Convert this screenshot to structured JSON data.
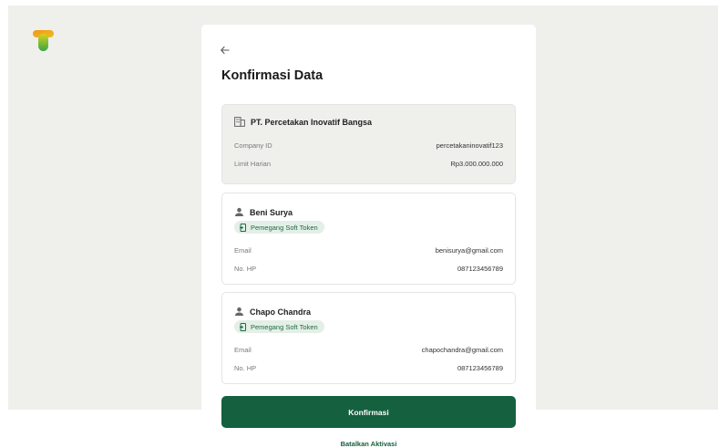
{
  "header": {
    "back_icon": "arrow-left-icon",
    "title": "Konfirmasi Data"
  },
  "company": {
    "name": "PT. Percetakan Inovatif Bangsa",
    "icon": "building-icon",
    "fields": [
      {
        "label": "Company ID",
        "value": "percetakaninovatif123"
      },
      {
        "label": "Limit Harian",
        "value": "Rp3.000.000.000"
      }
    ]
  },
  "persons": [
    {
      "name": "Beni Surya",
      "badge": "Pemegang Soft Token",
      "fields": [
        {
          "label": "Email",
          "value": "benisurya@gmail.com"
        },
        {
          "label": "No. HP",
          "value": "087123456789"
        }
      ]
    },
    {
      "name": "Chapo Chandra",
      "badge": "Pemegang Soft Token",
      "fields": [
        {
          "label": "Email",
          "value": "chapochandra@gmail.com"
        },
        {
          "label": "No. HP",
          "value": "087123456789"
        }
      ]
    }
  ],
  "actions": {
    "confirm_label": "Konfirmasi",
    "cancel_label": "Batalkan Aktivasi"
  },
  "colors": {
    "primary": "#14603f",
    "badge_bg": "#e4efe7",
    "background": "#eff0ec"
  }
}
